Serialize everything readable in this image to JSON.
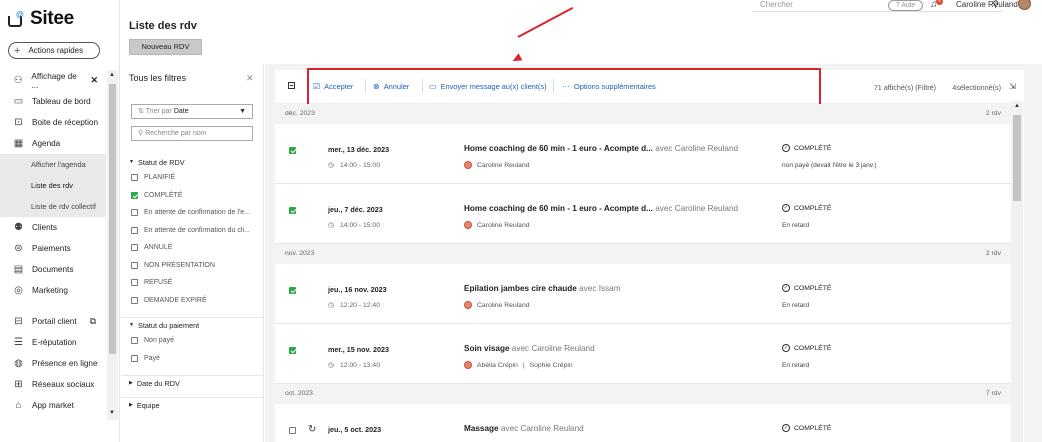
{
  "app": {
    "logo_text": "Sitee",
    "quick_actions_label": "Actions rapides"
  },
  "topbar": {
    "search_placeholder": "Chercher",
    "help_label": "? Aide",
    "notif_count": "6",
    "user_name": "Caroline Reuland"
  },
  "sidebar": {
    "items": [
      {
        "label": "Affichage de ...",
        "icon": "user-search-icon"
      },
      {
        "label": "Tableau de bord",
        "icon": "dashboard-icon"
      },
      {
        "label": "Boite de réception",
        "icon": "inbox-icon"
      },
      {
        "label": "Agenda",
        "icon": "calendar-icon"
      }
    ],
    "sub_items": [
      {
        "label": "Afficher l'agenda"
      },
      {
        "label": "Liste des rdv"
      },
      {
        "label": "Liste de rdv collectif"
      }
    ],
    "items2": [
      {
        "label": "Clients",
        "icon": "users-icon"
      },
      {
        "label": "Paiements",
        "icon": "payments-icon"
      },
      {
        "label": "Documents",
        "icon": "document-icon"
      },
      {
        "label": "Marketing",
        "icon": "target-icon"
      }
    ],
    "items3": [
      {
        "label": "Portail client",
        "icon": "portal-icon"
      },
      {
        "label": "E-réputation",
        "icon": "reputation-icon"
      },
      {
        "label": "Présence en ligne",
        "icon": "globe-icon"
      },
      {
        "label": "Réseaux sociaux",
        "icon": "social-icon"
      },
      {
        "label": "App market",
        "icon": "store-icon"
      }
    ]
  },
  "page": {
    "title": "Liste des rdv",
    "new_button": "Nouveau RDV"
  },
  "filters": {
    "title": "Tous les filtres",
    "sort_prefix": "Trier par",
    "sort_value": "Date",
    "search_placeholder": "Recherche par nom",
    "status_title": "Statut de RDV",
    "status_options": [
      {
        "label": "PLANIFIÉ",
        "checked": false
      },
      {
        "label": "COMPLÉTÉ",
        "checked": true
      },
      {
        "label": "En attente de confirmation de l'e...",
        "checked": false
      },
      {
        "label": "En attente de confirmation du cli...",
        "checked": false
      },
      {
        "label": "ANNULÉ",
        "checked": false
      },
      {
        "label": "NON PRÉSENTATION",
        "checked": false
      },
      {
        "label": "REFUSÉ",
        "checked": false
      },
      {
        "label": "DEMANDE EXPIRÉ",
        "checked": false
      }
    ],
    "payment_title": "Statut du paiement",
    "payment_options": [
      {
        "label": "Non payé",
        "checked": false
      },
      {
        "label": "Payé",
        "checked": false
      }
    ],
    "date_title": "Date du RDV",
    "team_title": "Equipe"
  },
  "toolbar": {
    "accept": "Accepter",
    "cancel": "Annuler",
    "message": "Envoyer message au(x) client(s)",
    "more": "Options supplémentaires",
    "count": "71 affiché(s) (Filtré)",
    "selected": "4sélectionné(s)"
  },
  "groups": [
    {
      "month": "déc. 2023",
      "count": "2 rdv",
      "appointments": [
        {
          "date": "mer., 13 déc. 2023",
          "time": "14:00 - 15:00",
          "service": "Home coaching de 60 min - 1 euro - Acompte d...",
          "with": "avec Caroline Reuland",
          "staff": "Caroline Reuland",
          "staff2": "",
          "status": "COMPLÉTÉ",
          "payment": "non payé (devait l'être le 3 janv.)",
          "checked": true
        },
        {
          "date": "jeu., 7 déc. 2023",
          "time": "14:00 - 15:00",
          "service": "Home coaching de 60 min - 1 euro - Acompte d...",
          "with": "avec Caroline Reuland",
          "staff": "Caroline Reuland",
          "staff2": "",
          "status": "COMPLÉTÉ",
          "payment": "En retard",
          "checked": true
        }
      ]
    },
    {
      "month": "nov. 2023",
      "count": "2 rdv",
      "appointments": [
        {
          "date": "jeu., 16 nov. 2023",
          "time": "12:20 - 12:40",
          "service": "Epilation jambes cire chaude",
          "with": "avec Issam",
          "staff": "Caroline Reuland",
          "staff2": "",
          "status": "COMPLÉTÉ",
          "payment": "En retard",
          "checked": true
        },
        {
          "date": "mer., 15 nov. 2023",
          "time": "12:00 - 13:40",
          "service": "Soin visage",
          "with": "avec Caroline Reuland",
          "staff": "Abélia Crépin",
          "staff2": "Sophie Crépin",
          "status": "COMPLÉTÉ",
          "payment": "En retard",
          "checked": true
        }
      ]
    },
    {
      "month": "oct. 2023",
      "count": "7 rdv",
      "appointments": [
        {
          "date": "jeu., 5 oct. 2023",
          "time": "",
          "service": "Massage",
          "with": "avec Caroline Reuland",
          "staff": "",
          "staff2": "",
          "status": "COMPLÉTÉ",
          "payment": "",
          "checked": false
        }
      ]
    }
  ],
  "colors": {
    "accent": "#1f5fbf",
    "highlight": "#d9232d",
    "check": "#2aa84a"
  }
}
